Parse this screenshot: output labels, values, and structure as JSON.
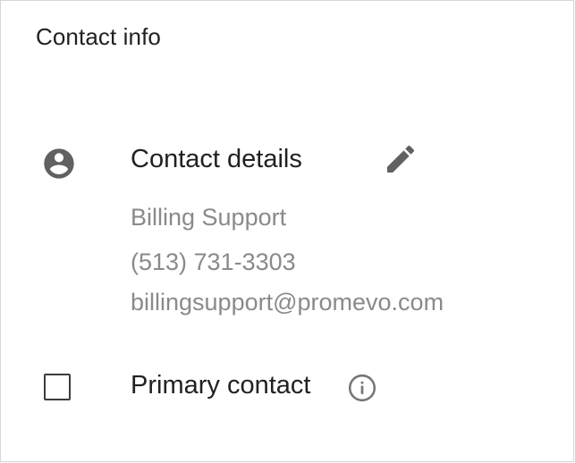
{
  "card": {
    "title": "Contact info"
  },
  "contact_details": {
    "heading": "Contact details",
    "icon": "account-circle-icon",
    "edit_icon": "pencil-icon",
    "name": "Billing Support",
    "phone": "(513) 731-3303",
    "email": "billingsupport@promevo.com"
  },
  "primary_contact": {
    "label": "Primary contact",
    "checked": false,
    "info_icon": "info-icon"
  },
  "colors": {
    "text_primary": "#212121",
    "text_secondary": "#8a8a8a",
    "icon": "#616161",
    "border": "#d6d6d6"
  }
}
